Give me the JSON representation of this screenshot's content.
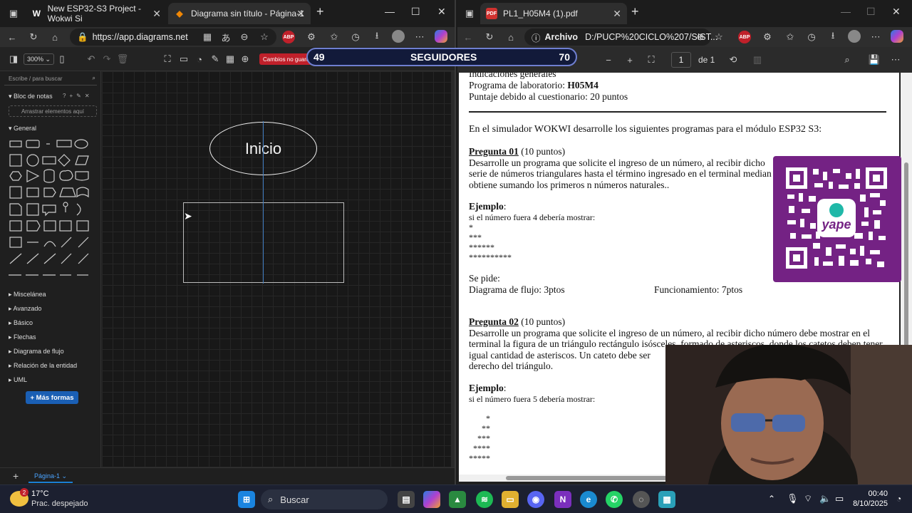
{
  "left_browser": {
    "tabs": [
      {
        "title": "New ESP32-S3 Project - Wokwi Si",
        "active": false
      },
      {
        "title": "Diagrama sin título - Página-1",
        "active": true
      }
    ],
    "url": "https://app.diagrams.net"
  },
  "drawio": {
    "zoom": "300%",
    "unsaved": "Cambios no guard",
    "search_placeholder": "Escribe / para buscar",
    "scratchpad": {
      "title": "Bloc de notas",
      "drop_hint": "Arrastrar elementos aquí"
    },
    "general_label": "General",
    "categories": [
      "Miscelánea",
      "Avanzado",
      "Básico",
      "Flechas",
      "Diagrama de flujo",
      "Relación de la entidad",
      "UML"
    ],
    "more_shapes": "+ Más formas",
    "page_tab": "Página-1",
    "canvas_text": "Inicio"
  },
  "followers": {
    "left": "49",
    "label": "SEGUIDORES",
    "right": "70"
  },
  "right_browser": {
    "tab_title": "PL1_H05M4 (1).pdf",
    "archive_label": "Archivo",
    "path": "D:/PUCP%20CICLO%207/SIST...",
    "page_current": "1",
    "page_total": "de 1"
  },
  "pdf": {
    "heading": "Indicaciones generales",
    "lab_prefix": "Programa de laboratorio: ",
    "lab_code": "H05M4",
    "score": "Puntaje debido al cuestionario: 20 puntos",
    "intro": "En el simulador WOKWI desarrolle los siguientes programas para el módulo ESP32 S3:",
    "q1_title": "Pregunta 01",
    "q1_points": " (10 puntos)",
    "q1_line1": "Desarrolle un programa que solicite el ingreso de un número, al recibir dicho",
    "q1_line2": "serie de números triangulares hasta el término ingresado en el terminal median",
    "q1_line3": "obtiene sumando los primeros n números naturales..",
    "example_title": "Ejemplo",
    "example1_text": "si el número fuera 4  debería mostrar:",
    "example1_lines": [
      "*",
      "***",
      "******",
      "**********"
    ],
    "asks": "Se pide:",
    "flow": "Diagrama de flujo: 3ptos",
    "function": "Funcionamiento:    7ptos",
    "q2_title": "Pregunta 02",
    "q2_points": " (10 puntos)",
    "q2_line1": "Desarrolle un programa que solicite el ingreso de un número, al recibir dicho número debe mostrar en el",
    "q2_line2": "terminal la figura de un triángulo rectángulo isósceles, formado de asteriscos, donde los catetos deben tener",
    "q2_line3": "igual cantidad de asteriscos. Un cateto debe ser",
    "q2_line4": "derecho del triángulo.",
    "example2_text": "si el número fuera 5 debería mostrar:",
    "example2_lines": [
      "*",
      "**",
      "***",
      "****",
      "*****"
    ]
  },
  "taskbar": {
    "weather_temp": "17°C",
    "weather_desc": "Prac. despejado",
    "weather_badge": "2",
    "search": "Buscar",
    "time": "00:40",
    "date": "8/10/2025"
  }
}
